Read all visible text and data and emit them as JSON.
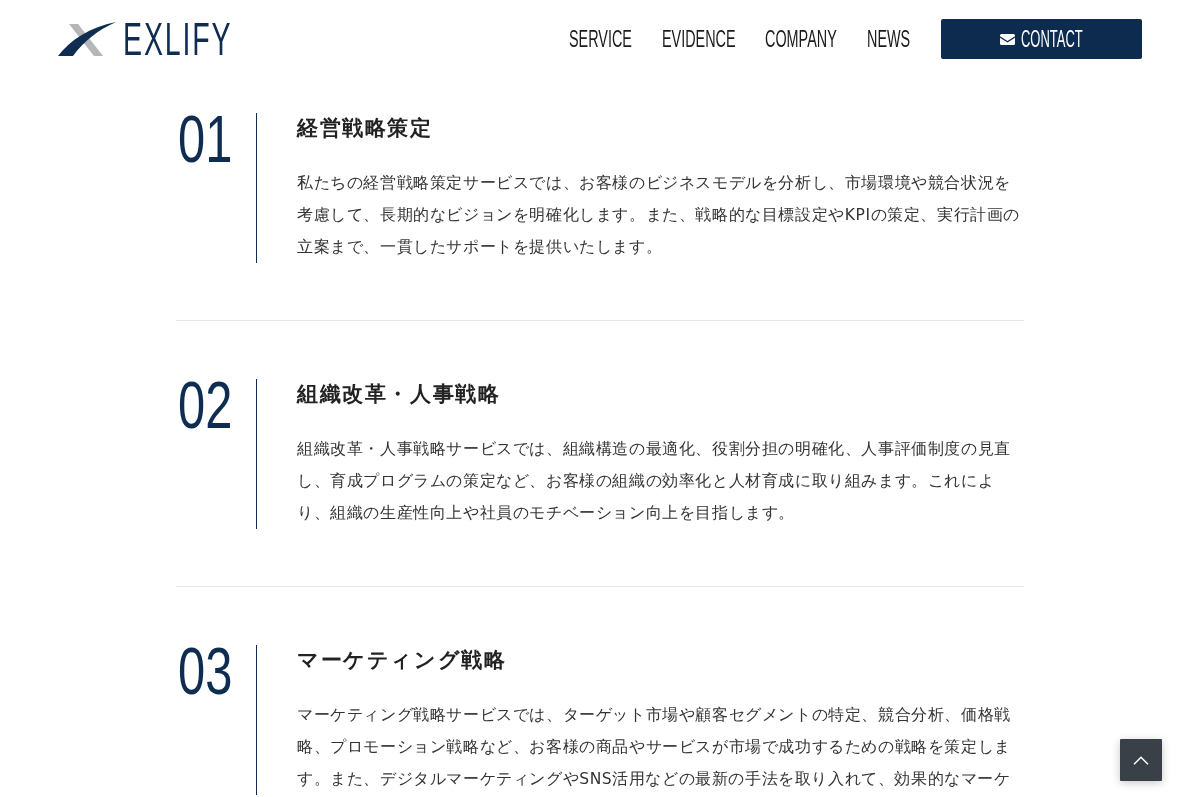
{
  "header": {
    "logo": {
      "text": "EXLIFY"
    },
    "nav": [
      {
        "label": "SERVICE"
      },
      {
        "label": "EVIDENCE"
      },
      {
        "label": "COMPANY"
      },
      {
        "label": "NEWS"
      }
    ],
    "contact_button": {
      "label": "CONTACT"
    }
  },
  "services": [
    {
      "number": "01",
      "title": "経営戦略策定",
      "description": "私たちの経営戦略策定サービスでは、お客様のビジネスモデルを分析し、市場環境や競合状況を考慮して、長期的なビジョンを明確化します。また、戦略的な目標設定やKPIの策定、実行計画の立案まで、一貫したサポートを提供いたします。"
    },
    {
      "number": "02",
      "title": "組織改革・人事戦略",
      "description": "組織改革・人事戦略サービスでは、組織構造の最適化、役割分担の明確化、人事評価制度の見直し、育成プログラムの策定など、お客様の組織の効率化と人材育成に取り組みます。これにより、組織の生産性向上や社員のモチベーション向上を目指します。"
    },
    {
      "number": "03",
      "title": "マーケティング戦略",
      "description": "マーケティング戦略サービスでは、ターゲット市場や顧客セグメントの特定、競合分析、価格戦略、プロモーション戦略など、お客様の商品やサービスが市場で成功するための戦略を策定します。また、デジタルマーケティングやSNS活用などの最新の手法を取り入れて、効果的なマーケ"
    }
  ],
  "page_top_button": {
    "shown": true
  }
}
